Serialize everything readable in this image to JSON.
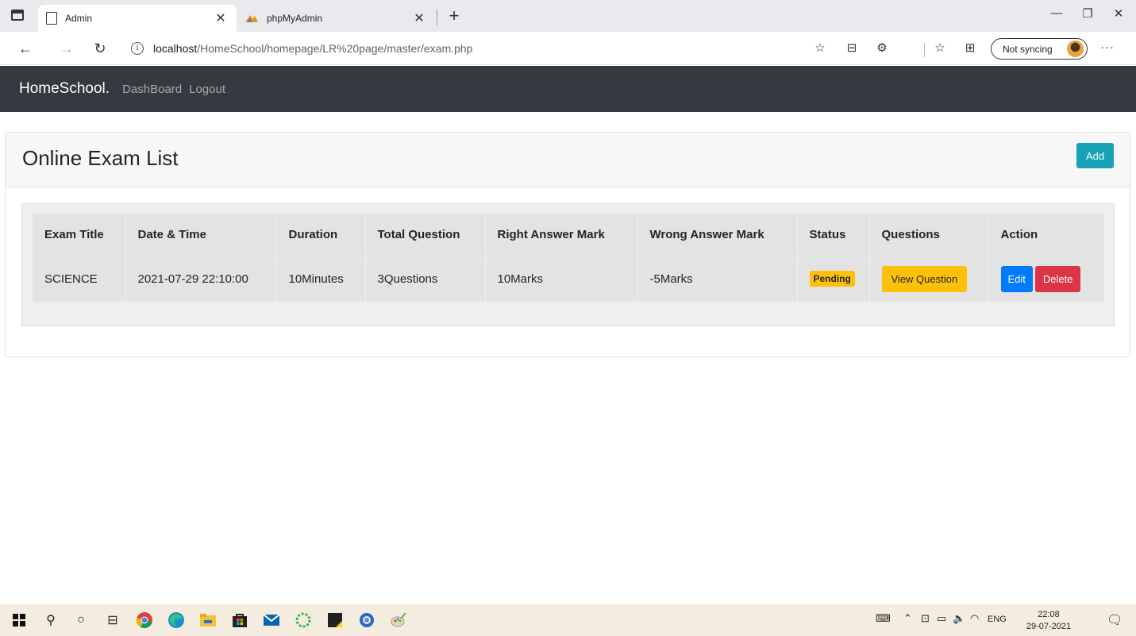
{
  "browser": {
    "tabs": [
      {
        "title": "Admin",
        "close": "✕"
      },
      {
        "title": "phpMyAdmin",
        "close": "✕"
      }
    ],
    "new_tab": "+",
    "window_controls": {
      "minimize": "—",
      "restore": "❐",
      "close": "✕"
    },
    "url_host": "localhost",
    "url_path": "/HomeSchool/homepage/LR%20page/master/exam.php",
    "sync_label": "Not syncing",
    "more": "···"
  },
  "navbar": {
    "brand": "HomeSchool.",
    "links": [
      "DashBoard",
      "Logout"
    ]
  },
  "card": {
    "title": "Online Exam List",
    "add_label": "Add"
  },
  "table": {
    "headers": [
      "Exam Title",
      "Date & Time",
      "Duration",
      "Total Question",
      "Right Answer Mark",
      "Wrong Answer Mark",
      "Status",
      "Questions",
      "Action"
    ],
    "rows": [
      {
        "title": "SCIENCE",
        "datetime": "2021-07-29 22:10:00",
        "duration": "10Minutes",
        "total_question": "3Questions",
        "right_mark": "10Marks",
        "wrong_mark": "-5Marks",
        "status": "Pending",
        "view_label": "View Question",
        "edit_label": "Edit",
        "delete_label": "Delete"
      }
    ]
  },
  "colors": {
    "navbar_bg": "#343a40",
    "info": "#17a2b8",
    "warning": "#ffc107",
    "primary": "#007bff",
    "danger": "#dc3545"
  },
  "taskbar": {
    "language": "ENG",
    "time": "22:08",
    "date": "29-07-2021"
  }
}
